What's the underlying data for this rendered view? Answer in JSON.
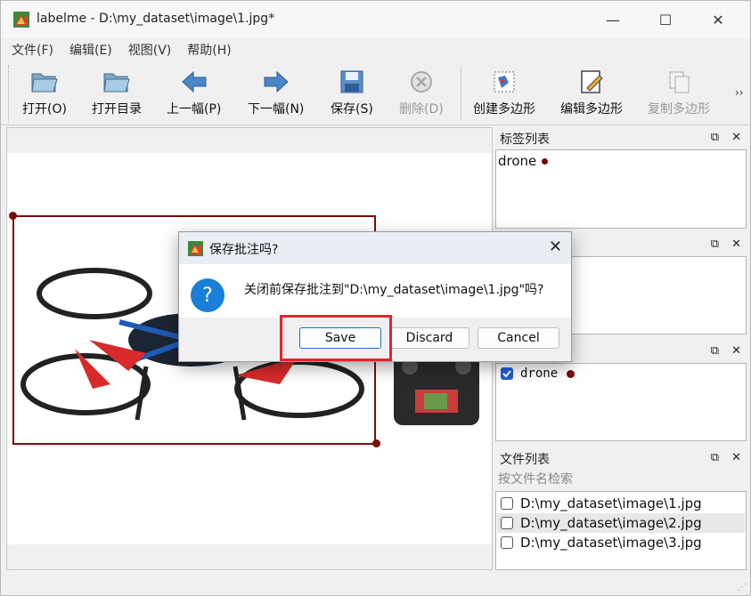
{
  "window": {
    "title": "labelme - D:\\my_dataset\\image\\1.jpg*",
    "minimize_glyph": "—",
    "maximize_glyph": "☐",
    "close_glyph": "✕"
  },
  "menu": [
    "文件(F)",
    "编辑(E)",
    "视图(V)",
    "帮助(H)"
  ],
  "toolbar": {
    "open": "打开(O)",
    "open_dir": "打开目录",
    "prev": "上一幅(P)",
    "next": "下一幅(N)",
    "save": "保存(S)",
    "delete": "删除(D)",
    "create_polygon": "创建多边形",
    "edit_polygon": "编辑多边形",
    "copy_polygon": "复制多边形",
    "more": "››"
  },
  "docks": {
    "label_list": {
      "title": "标签列表",
      "items": [
        {
          "text": "drone"
        }
      ]
    },
    "polygon_list": {
      "items": [
        {
          "text": "drone",
          "checked": true
        }
      ]
    },
    "file_list": {
      "title": "文件列表",
      "search_placeholder": "按文件名检索",
      "files": [
        {
          "path": "D:\\my_dataset\\image\\1.jpg",
          "checked": false
        },
        {
          "path": "D:\\my_dataset\\image\\2.jpg",
          "checked": false,
          "selected": true
        },
        {
          "path": "D:\\my_dataset\\image\\3.jpg",
          "checked": false
        }
      ]
    },
    "float_glyph": "⧉",
    "close_glyph": "✕"
  },
  "dialog": {
    "title": "保存批注吗?",
    "message": "关闭前保存批注到\"D:\\my_dataset\\image\\1.jpg\"吗?",
    "question_glyph": "?",
    "close_glyph": "✕",
    "buttons": {
      "save": "Save",
      "discard": "Discard",
      "cancel": "Cancel"
    }
  },
  "colors": {
    "shape": "#7a0c0c",
    "highlight": "#e8232a",
    "info": "#1a7fd8"
  }
}
